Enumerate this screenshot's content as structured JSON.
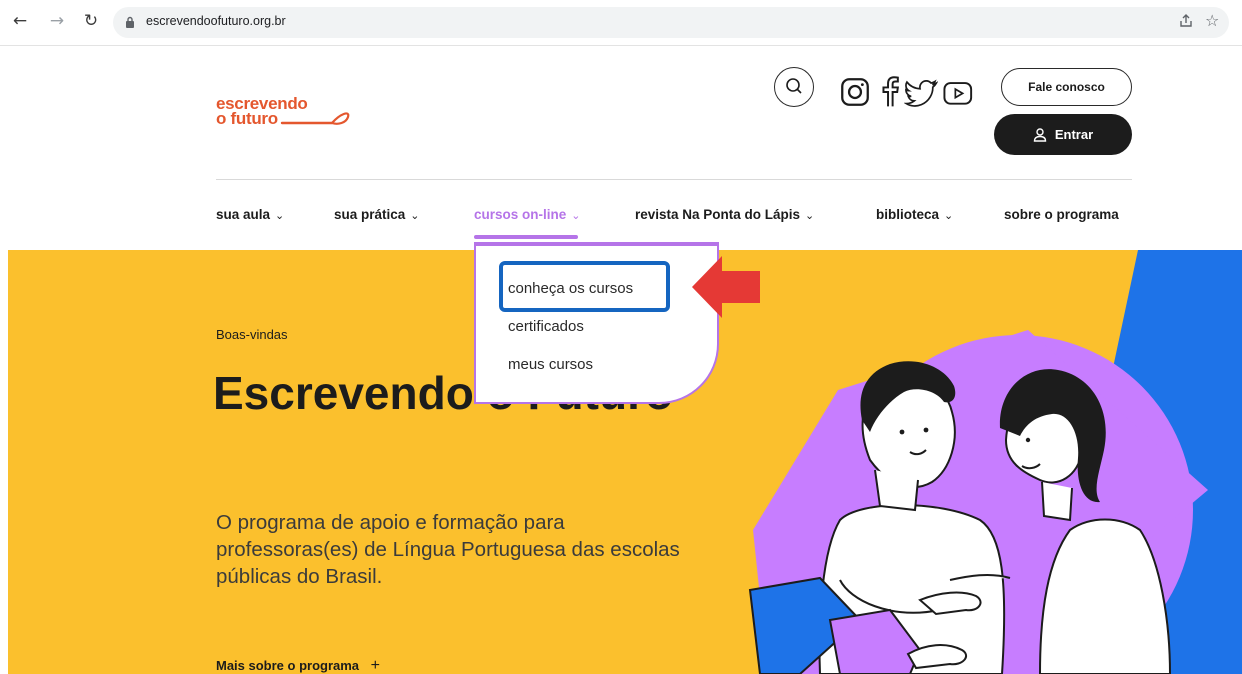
{
  "browser": {
    "url": "escrevendoofuturo.org.br"
  },
  "header": {
    "logo_line1": "escrevendo",
    "logo_line2": "o futuro",
    "fale_label": "Fale conosco",
    "entrar_label": "Entrar"
  },
  "nav": {
    "items": [
      {
        "label": "sua aula"
      },
      {
        "label": "sua prática"
      },
      {
        "label": "cursos on-line"
      },
      {
        "label": "revista Na Ponta do Lápis"
      },
      {
        "label": "biblioteca"
      },
      {
        "label": "sobre o programa"
      }
    ]
  },
  "dropdown": {
    "items": [
      {
        "label": "conheça os cursos"
      },
      {
        "label": "certificados"
      },
      {
        "label": "meus cursos"
      }
    ]
  },
  "hero": {
    "eyebrow": "Boas-vindas",
    "title": "Escrevendo o Futuro",
    "description": "O programa de apoio e formação para professoras(es) de Língua Portuguesa das escolas públicas do Brasil.",
    "more_label": "Mais sobre o programa",
    "more_icon": "+"
  },
  "colors": {
    "accent_purple": "#b574e8",
    "hero_yellow": "#fbc02d",
    "hero_blue": "#1e73e8",
    "logo_orange": "#e4572e",
    "highlight_blue": "#1565c0",
    "arrow_red": "#e53935"
  }
}
